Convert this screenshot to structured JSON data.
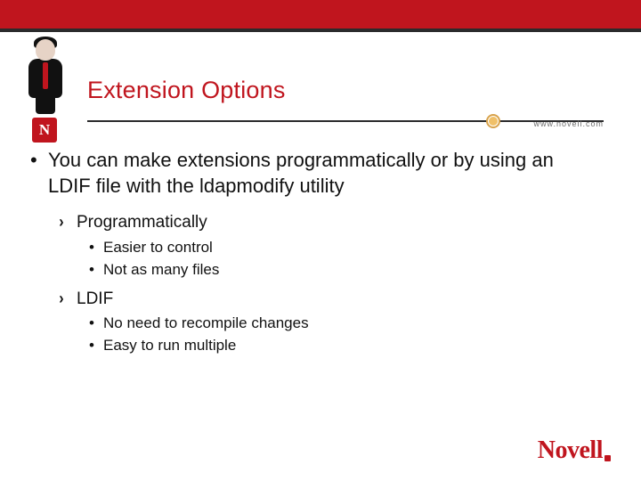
{
  "brand": {
    "badge_letter": "N",
    "site_label": "www.novell.com",
    "footer_logo": "Novell"
  },
  "slide": {
    "title": "Extension Options",
    "bullets": {
      "main": "You can make extensions programmatically or by using an LDIF file with the ldapmodify utility",
      "sub1": {
        "label": "Programmatically",
        "items": [
          "Easier to control",
          "Not as many files"
        ]
      },
      "sub2": {
        "label": "LDIF",
        "items": [
          "No need to recompile changes",
          "Easy to run multiple"
        ]
      }
    }
  }
}
